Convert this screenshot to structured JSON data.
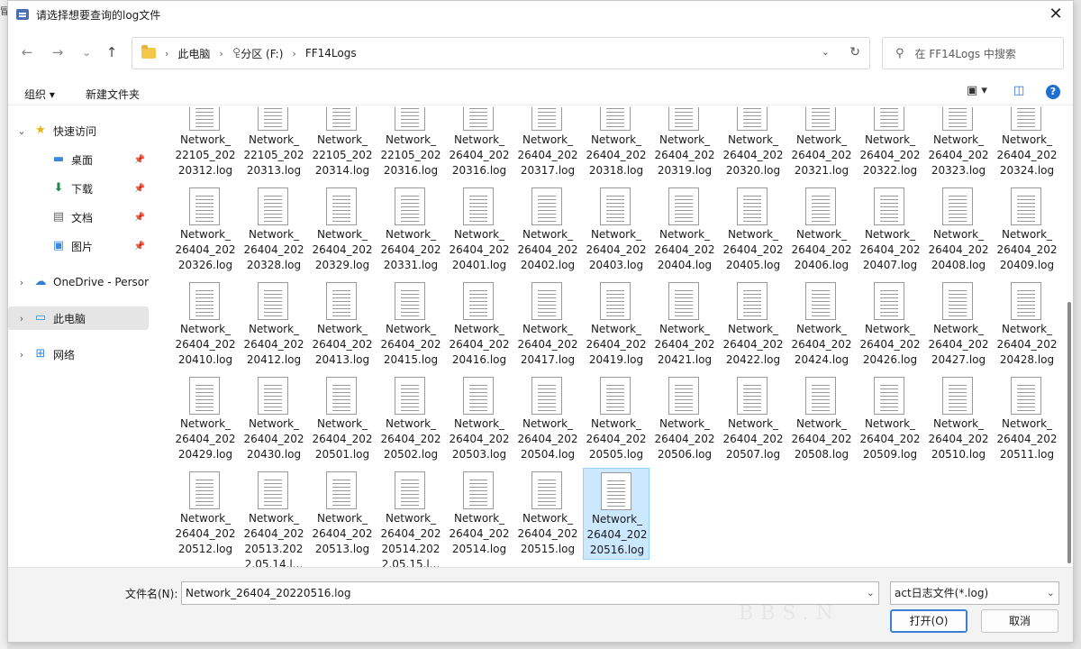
{
  "window": {
    "title": "请选择想要查询的log文件",
    "side_glyph": "冒"
  },
  "nav": {
    "back": "←",
    "forward": "→",
    "recent": "⌄",
    "up": "↑",
    "breadcrumb": [
      "此电脑",
      "ꄗ分区 (F:)",
      "FF14Logs"
    ],
    "search_placeholder": "在 FF14Logs 中搜索"
  },
  "toolbar": {
    "organize": "组织 ▾",
    "new_folder": "新建文件夹"
  },
  "sidebar": {
    "items": [
      {
        "label": "快速访问",
        "icon": "star-icon",
        "glyph": "★",
        "chev": "⌄"
      },
      {
        "label": "桌面",
        "icon": "desktop-icon",
        "glyph": "▬",
        "pin": true
      },
      {
        "label": "下载",
        "icon": "download-icon",
        "glyph": "⬇",
        "pin": true
      },
      {
        "label": "文档",
        "icon": "document-icon",
        "glyph": "▤",
        "pin": true
      },
      {
        "label": "图片",
        "icon": "picture-icon",
        "glyph": "▣",
        "pin": true
      },
      {
        "label": "OneDrive - Persor",
        "icon": "cloud-icon",
        "glyph": "☁",
        "chev": "›"
      },
      {
        "label": "此电脑",
        "icon": "computer-icon",
        "glyph": "▭",
        "chev": "›",
        "selected": true
      },
      {
        "label": "网络",
        "icon": "network-icon",
        "glyph": "⊞",
        "chev": "›"
      }
    ]
  },
  "files": [
    [
      "Network_",
      "22105_202",
      "20312.log"
    ],
    [
      "Network_",
      "22105_202",
      "20313.log"
    ],
    [
      "Network_",
      "22105_202",
      "20314.log"
    ],
    [
      "Network_",
      "22105_202",
      "20316.log"
    ],
    [
      "Network_",
      "26404_202",
      "20316.log"
    ],
    [
      "Network_",
      "26404_202",
      "20317.log"
    ],
    [
      "Network_",
      "26404_202",
      "20318.log"
    ],
    [
      "Network_",
      "26404_202",
      "20319.log"
    ],
    [
      "Network_",
      "26404_202",
      "20320.log"
    ],
    [
      "Network_",
      "26404_202",
      "20321.log"
    ],
    [
      "Network_",
      "26404_202",
      "20322.log"
    ],
    [
      "Network_",
      "26404_202",
      "20323.log"
    ],
    [
      "Network_",
      "26404_202",
      "20324.log"
    ],
    [
      "Network_",
      "26404_202",
      "20326.log"
    ],
    [
      "Network_",
      "26404_202",
      "20328.log"
    ],
    [
      "Network_",
      "26404_202",
      "20329.log"
    ],
    [
      "Network_",
      "26404_202",
      "20331.log"
    ],
    [
      "Network_",
      "26404_202",
      "20401.log"
    ],
    [
      "Network_",
      "26404_202",
      "20402.log"
    ],
    [
      "Network_",
      "26404_202",
      "20403.log"
    ],
    [
      "Network_",
      "26404_202",
      "20404.log"
    ],
    [
      "Network_",
      "26404_202",
      "20405.log"
    ],
    [
      "Network_",
      "26404_202",
      "20406.log"
    ],
    [
      "Network_",
      "26404_202",
      "20407.log"
    ],
    [
      "Network_",
      "26404_202",
      "20408.log"
    ],
    [
      "Network_",
      "26404_202",
      "20409.log"
    ],
    [
      "Network_",
      "26404_202",
      "20410.log"
    ],
    [
      "Network_",
      "26404_202",
      "20412.log"
    ],
    [
      "Network_",
      "26404_202",
      "20413.log"
    ],
    [
      "Network_",
      "26404_202",
      "20415.log"
    ],
    [
      "Network_",
      "26404_202",
      "20416.log"
    ],
    [
      "Network_",
      "26404_202",
      "20417.log"
    ],
    [
      "Network_",
      "26404_202",
      "20419.log"
    ],
    [
      "Network_",
      "26404_202",
      "20421.log"
    ],
    [
      "Network_",
      "26404_202",
      "20422.log"
    ],
    [
      "Network_",
      "26404_202",
      "20424.log"
    ],
    [
      "Network_",
      "26404_202",
      "20426.log"
    ],
    [
      "Network_",
      "26404_202",
      "20427.log"
    ],
    [
      "Network_",
      "26404_202",
      "20428.log"
    ],
    [
      "Network_",
      "26404_202",
      "20429.log"
    ],
    [
      "Network_",
      "26404_202",
      "20430.log"
    ],
    [
      "Network_",
      "26404_202",
      "20501.log"
    ],
    [
      "Network_",
      "26404_202",
      "20502.log"
    ],
    [
      "Network_",
      "26404_202",
      "20503.log"
    ],
    [
      "Network_",
      "26404_202",
      "20504.log"
    ],
    [
      "Network_",
      "26404_202",
      "20505.log"
    ],
    [
      "Network_",
      "26404_202",
      "20506.log"
    ],
    [
      "Network_",
      "26404_202",
      "20507.log"
    ],
    [
      "Network_",
      "26404_202",
      "20508.log"
    ],
    [
      "Network_",
      "26404_202",
      "20509.log"
    ],
    [
      "Network_",
      "26404_202",
      "20510.log"
    ],
    [
      "Network_",
      "26404_202",
      "20511.log"
    ],
    [
      "Network_",
      "26404_202",
      "20512.log"
    ],
    [
      "Network_",
      "26404_202",
      "20513.202",
      "2.05.14.l..."
    ],
    [
      "Network_",
      "26404_202",
      "20513.log"
    ],
    [
      "Network_",
      "26404_202",
      "20514.202",
      "2.05.15.l..."
    ],
    [
      "Network_",
      "26404_202",
      "20514.log"
    ],
    [
      "Network_",
      "26404_202",
      "20515.log"
    ],
    [
      "Network_",
      "26404_202",
      "20516.log"
    ]
  ],
  "selected_file_index": 58,
  "footer": {
    "filename_label": "文件名(N):",
    "filename_value": "Network_26404_20220516.log",
    "filetype_value": "act日志文件(*.log)",
    "open_label": "打开(O)",
    "cancel_label": "取消",
    "watermark": "BBS.N"
  },
  "colors": {
    "selection_bg": "#cce8ff",
    "accent": "#1f6fd1"
  }
}
